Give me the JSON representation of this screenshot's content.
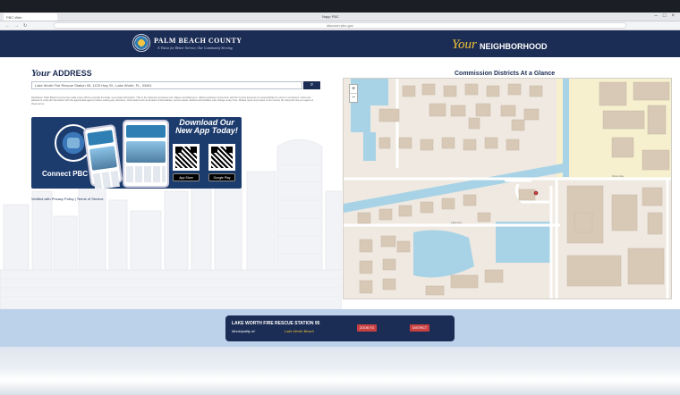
{
  "browser": {
    "tab_label": "PBC Web",
    "window_title": "Napp PBC",
    "url": "discover.pbc.gov",
    "controls": [
      "–",
      "□",
      "×"
    ],
    "nav": [
      "←",
      "→",
      "↻"
    ]
  },
  "header": {
    "county_name": "PALM BEACH COUNTY",
    "county_tagline": "A Vision for Better Service, Our Community Serving",
    "your": "Your",
    "neighborhood": "NEIGHBORHOOD"
  },
  "address_panel": {
    "title_your": "Your",
    "title_rest": "ADDRESS",
    "address_value": "Lake Worth Fire Rescue Station 95, 1120 Hwy St., Lake Worth, FL, 33461",
    "search_icon": "search-icon",
    "disclaimer": "Disclaimer: Palm Beach County has made every effort to provide accurate, up-to-date information. This is for reference purposes only. Data is provided as is, without warranty of any kind, and the County assumes no responsibility for errors or omissions. Users are advised to verify all information with the appropriate agency before making any decisions. Information such as location of boundaries, service areas, districts and facilities may change at any time. Please report any issues to the County. By using this site you agree to these terms.",
    "promo": {
      "connect": "Connect PBC",
      "download": "Download Our New App Today!",
      "app_store": "App Store",
      "google_play": "Google Play"
    },
    "privacy_link": "Verified with Privacy Policy | Terms of Service"
  },
  "map_panel": {
    "title": "Commission Districts At a Glance",
    "zoom_in": "+",
    "zoom_out": "−"
  },
  "station": {
    "name": "LAKE WORTH FIRE RESCUE STATION 95",
    "municipality_label": "Municipality of:",
    "municipality_value": "Lake Worth Beach",
    "button_1": "ZOOM TO",
    "button_2": "DISTRICT"
  },
  "colors": {
    "navy": "#1c2d55",
    "gold": "#f1c232",
    "map_bg": "#efe9e1",
    "water": "#a8d3e6",
    "building": "#d8c9b7",
    "station_bar": "#bcd1ea",
    "marker": "#c94040"
  }
}
